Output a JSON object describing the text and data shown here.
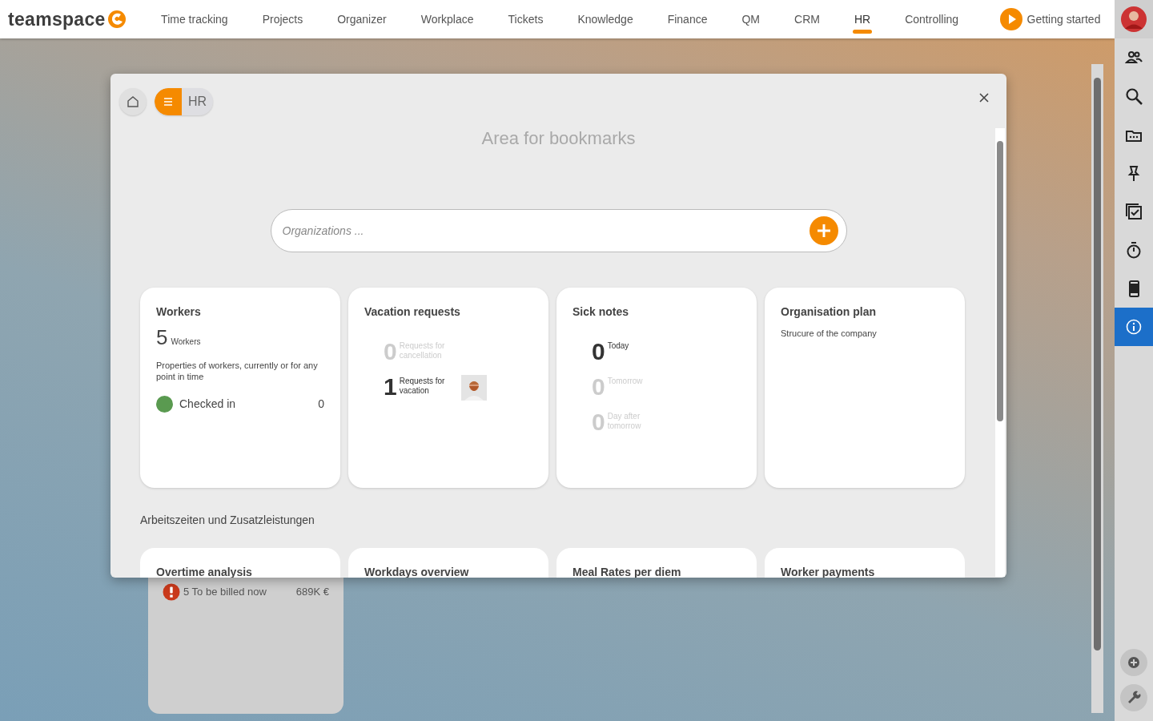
{
  "top_nav": {
    "logo": "teamspace",
    "items": [
      {
        "label": "Time tracking",
        "selected": false
      },
      {
        "label": "Projects",
        "selected": false
      },
      {
        "label": "Organizer",
        "selected": false
      },
      {
        "label": "Workplace",
        "selected": false
      },
      {
        "label": "Tickets",
        "selected": false
      },
      {
        "label": "Knowledge",
        "selected": false
      },
      {
        "label": "Finance",
        "selected": false
      },
      {
        "label": "QM",
        "selected": false
      },
      {
        "label": "CRM",
        "selected": false
      },
      {
        "label": "HR",
        "selected": true
      },
      {
        "label": "Controlling",
        "selected": false
      }
    ],
    "getting_started": "Getting started"
  },
  "right_sidebar": {
    "items": [
      {
        "kind": "people",
        "selected": false
      },
      {
        "kind": "search",
        "selected": false
      },
      {
        "kind": "folder",
        "selected": false
      },
      {
        "kind": "pin",
        "selected": false
      },
      {
        "kind": "tasks",
        "selected": false
      },
      {
        "kind": "timer",
        "selected": false
      },
      {
        "kind": "phone",
        "selected": false
      },
      {
        "kind": "info",
        "selected": true
      }
    ],
    "bottom": [
      {
        "kind": "add"
      },
      {
        "kind": "wrench"
      }
    ]
  },
  "background_card": {
    "alert": "5 To be billed now",
    "amount": "689K €"
  },
  "dialog": {
    "breadcrumb": "HR",
    "bookmarks_hint": "Area for bookmarks",
    "search": {
      "placeholder": "Organizations ..."
    },
    "cards": [
      {
        "kind": "workers",
        "title": "Workers",
        "count": "5",
        "count_label": "Workers",
        "description": "Properties of workers, currently or for any point in time",
        "status": {
          "label": "Checked in",
          "value": "0",
          "color": "#5a9a50"
        }
      },
      {
        "kind": "counts",
        "title": "Vacation requests",
        "rows": [
          {
            "value": "0",
            "label": "Requests for cancellation",
            "muted": true
          },
          {
            "value": "1",
            "label": "Requests for vacation",
            "muted": false
          }
        ]
      },
      {
        "kind": "counts",
        "title": "Sick notes",
        "rows": [
          {
            "value": "0",
            "label": "Today",
            "muted": false
          },
          {
            "value": "0",
            "label": "Tomorrow",
            "muted": true
          },
          {
            "value": "0",
            "label": "Day after tomorrow",
            "muted": true
          }
        ]
      },
      {
        "kind": "text",
        "title": "Organisation plan",
        "description": "Strucure of the company"
      }
    ],
    "section_title": "Arbeitszeiten und Zusatzleistungen",
    "cards_2": [
      {
        "title": "Overtime analysis"
      },
      {
        "title": "Workdays overview"
      },
      {
        "title": "Meal Rates per diem"
      },
      {
        "title": "Worker payments"
      }
    ]
  }
}
